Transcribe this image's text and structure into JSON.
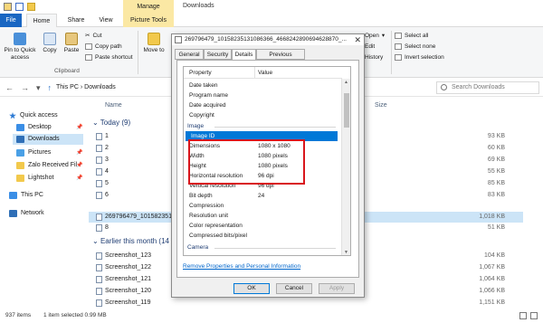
{
  "titlebar": {
    "manage_label": "Manage",
    "window_title": "Downloads"
  },
  "ribbon_tabs": [
    "File",
    "Home",
    "Share",
    "View",
    "Picture Tools"
  ],
  "ribbon": {
    "pin_label": "Pin to Quick access",
    "copy_label": "Copy",
    "paste_label": "Paste",
    "cut_label": "Cut",
    "copy_path_label": "Copy path",
    "paste_shortcut_label": "Paste shortcut",
    "move_to_label": "Move to",
    "clipboard_group": "Clipboard",
    "open_label": "Open",
    "edit_label": "Edit",
    "history_label": "History",
    "select_all_label": "Select all",
    "select_none_label": "Select none",
    "invert_selection_label": "Invert selection"
  },
  "address": {
    "path": [
      "This PC",
      "Downloads"
    ],
    "search_placeholder": "Search Downloads"
  },
  "navpane": {
    "items": [
      {
        "label": "Quick access",
        "icon": "star-icon",
        "pinned": false
      },
      {
        "label": "Desktop",
        "icon": "desktop-folder-icon",
        "pinned": true
      },
      {
        "label": "Downloads",
        "icon": "download-folder-icon",
        "pinned": true,
        "selected": true
      },
      {
        "label": "Pictures",
        "icon": "pictures-folder-icon",
        "pinned": true
      },
      {
        "label": "Zalo Received Fil",
        "icon": "folder-icon",
        "pinned": true
      },
      {
        "label": "Lightshot",
        "icon": "folder-icon",
        "pinned": true
      },
      {
        "label": "This PC",
        "icon": "computer-icon",
        "pinned": false
      },
      {
        "label": "Network",
        "icon": "network-icon",
        "pinned": false
      }
    ]
  },
  "filelist": {
    "col_name": "Name",
    "col_size": "Size",
    "group_today": "Today (9)",
    "today_files": [
      {
        "name": "1",
        "size": "93 KB"
      },
      {
        "name": "2",
        "size": "60 KB"
      },
      {
        "name": "3",
        "size": "69 KB"
      },
      {
        "name": "4",
        "size": "55 KB"
      },
      {
        "name": "5",
        "size": "85 KB"
      },
      {
        "name": "6",
        "size": "83 KB"
      },
      {
        "name": "269796479_1015823513",
        "size": "1,018 KB",
        "selected": true
      },
      {
        "name": "8",
        "size": "51 KB"
      }
    ],
    "group_earlier": "Earlier this month (14",
    "earlier_files": [
      {
        "name": "Screenshot_123",
        "size": "104 KB"
      },
      {
        "name": "Screenshot_122",
        "size": "1,067 KB"
      },
      {
        "name": "Screenshot_121",
        "size": "1,064 KB"
      },
      {
        "name": "Screenshot_120",
        "size": "1,066 KB"
      },
      {
        "name": "Screenshot_119",
        "size": "1,151 KB"
      }
    ]
  },
  "statusbar": {
    "items": "937 items",
    "selection": "1 item selected  0.99 MB"
  },
  "dialog": {
    "title": "269796479_10158235131086366_4668242890694628870_...",
    "tabs": [
      "General",
      "Security",
      "Details",
      "Previous Versions"
    ],
    "active_tab": "Details",
    "col_property": "Property",
    "col_value": "Value",
    "rows": [
      {
        "key": "Date taken",
        "value": ""
      },
      {
        "key": "Program name",
        "value": ""
      },
      {
        "key": "Date acquired",
        "value": ""
      },
      {
        "key": "Copyright",
        "value": ""
      },
      {
        "key": "Image",
        "value": "",
        "section": true
      },
      {
        "key": "Image ID",
        "value": "",
        "selected": true
      },
      {
        "key": "Dimensions",
        "value": "1080 x 1080"
      },
      {
        "key": "Width",
        "value": "1080 pixels"
      },
      {
        "key": "Height",
        "value": "1080 pixels"
      },
      {
        "key": "Horizontal resolution",
        "value": "96 dpi"
      },
      {
        "key": "Vertical resolution",
        "value": "96 dpi"
      },
      {
        "key": "Bit depth",
        "value": "24"
      },
      {
        "key": "Compression",
        "value": ""
      },
      {
        "key": "Resolution unit",
        "value": ""
      },
      {
        "key": "Color representation",
        "value": ""
      },
      {
        "key": "Compressed bits/pixel",
        "value": ""
      },
      {
        "key": "Camera",
        "value": "",
        "section": true
      }
    ],
    "remove_link": "Remove Properties and Personal Information",
    "ok_label": "OK",
    "cancel_label": "Cancel",
    "apply_label": "Apply",
    "highlight_color": "#d9161c"
  }
}
